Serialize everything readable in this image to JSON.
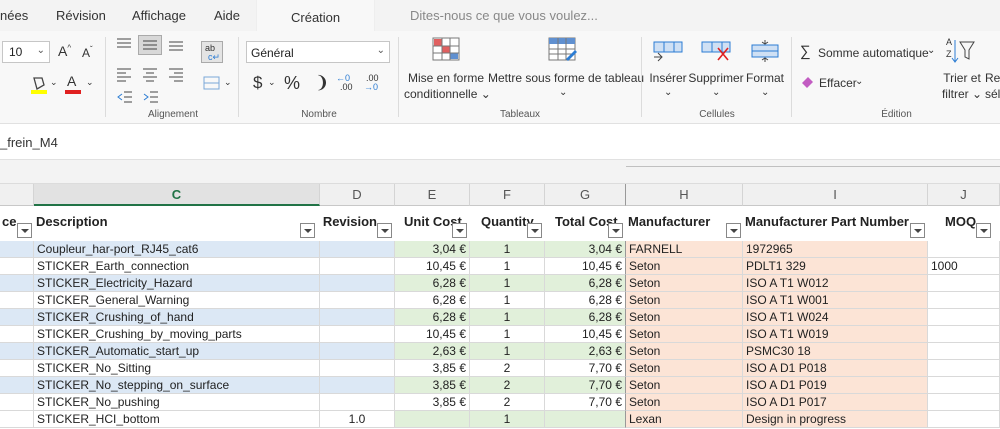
{
  "ribbon_tabs": [
    "nées",
    "Révision",
    "Affichage",
    "Aide",
    "Création"
  ],
  "tell_me": "Dites-nous ce que vous voulez...",
  "font": {
    "size": "10"
  },
  "number": {
    "format": "Général",
    "currency_symbol": "$",
    "percent_symbol": "%",
    "comma_symbol": "❩"
  },
  "groups": {
    "alignment": "Alignement",
    "number": "Nombre",
    "tables": "Tableaux",
    "cells": "Cellules",
    "editing": "Édition"
  },
  "buttons": {
    "conditional_1": "Mise en forme",
    "conditional_2": "conditionnelle ⌄",
    "format_table": "Mettre sous forme de tableau",
    "insert": "Insérer",
    "delete": "Supprimer",
    "format": "Format",
    "autosum": "Somme automatique",
    "clear": "Effacer",
    "sort_1": "Trier et",
    "sort_2": "filtrer ⌄",
    "find_1": "Re",
    "find_2": "sél"
  },
  "name_box": "_frein_M4",
  "columns": [
    "C",
    "D",
    "E",
    "F",
    "G",
    "H",
    "I",
    "J"
  ],
  "headers": {
    "b": "ce",
    "c": "Description",
    "d": "Revision",
    "e": "Unit Cost",
    "f": "Quantity",
    "g": "Total Cost",
    "h": "Manufacturer",
    "i": "Manufacturer Part Number",
    "j": "MOQ"
  },
  "rows": [
    {
      "desc": "Coupleur_har-port_RJ45_cat6",
      "rev": "",
      "unit": "3,04 €",
      "qty": "1",
      "total": "3,04 €",
      "mfr": "FARNELL",
      "part": "1972965",
      "moq": ""
    },
    {
      "desc": "STICKER_Earth_connection",
      "rev": "",
      "unit": "10,45 €",
      "qty": "1",
      "total": "10,45 €",
      "mfr": "Seton",
      "part": "PDLT1 329",
      "moq": "1000"
    },
    {
      "desc": "STICKER_Electricity_Hazard",
      "rev": "",
      "unit": "6,28 €",
      "qty": "1",
      "total": "6,28 €",
      "mfr": "Seton",
      "part": "ISO A T1 W012",
      "moq": ""
    },
    {
      "desc": "STICKER_General_Warning",
      "rev": "",
      "unit": "6,28 €",
      "qty": "1",
      "total": "6,28 €",
      "mfr": "Seton",
      "part": "ISO A T1 W001",
      "moq": ""
    },
    {
      "desc": "STICKER_Crushing_of_hand",
      "rev": "",
      "unit": "6,28 €",
      "qty": "1",
      "total": "6,28 €",
      "mfr": "Seton",
      "part": "ISO A T1 W024",
      "moq": ""
    },
    {
      "desc": "STICKER_Crushing_by_moving_parts",
      "rev": "",
      "unit": "10,45 €",
      "qty": "1",
      "total": "10,45 €",
      "mfr": "Seton",
      "part": "ISO A T1 W019",
      "moq": ""
    },
    {
      "desc": "STICKER_Automatic_start_up",
      "rev": "",
      "unit": "2,63 €",
      "qty": "1",
      "total": "2,63 €",
      "mfr": "Seton",
      "part": "PSMC30 18",
      "moq": ""
    },
    {
      "desc": "STICKER_No_Sitting",
      "rev": "",
      "unit": "3,85 €",
      "qty": "2",
      "total": "7,70 €",
      "mfr": "Seton",
      "part": "ISO A D1 P018",
      "moq": ""
    },
    {
      "desc": "STICKER_No_stepping_on_surface",
      "rev": "",
      "unit": "3,85 €",
      "qty": "2",
      "total": "7,70 €",
      "mfr": "Seton",
      "part": "ISO A D1 P019",
      "moq": ""
    },
    {
      "desc": "STICKER_No_pushing",
      "rev": "",
      "unit": "3,85 €",
      "qty": "2",
      "total": "7,70 €",
      "mfr": "Seton",
      "part": "ISO A D1 P017",
      "moq": ""
    },
    {
      "desc": "STICKER_HCI_bottom",
      "rev": "1.0",
      "unit": "",
      "qty": "1",
      "total": "",
      "mfr": "Lexan",
      "part": "Design in progress",
      "moq": ""
    }
  ]
}
